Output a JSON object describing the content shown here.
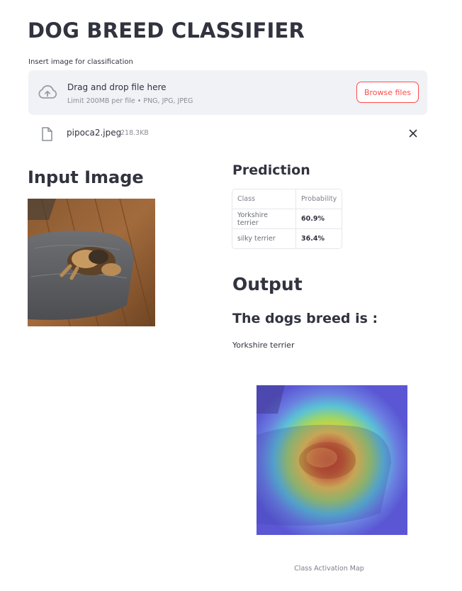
{
  "page": {
    "title": "DOG BREED CLASSIFIER"
  },
  "uploader": {
    "label": "Insert image for classification",
    "drop_text": "Drag and drop file here",
    "limit_text": "Limit 200MB per file • PNG, JPG, JPEG",
    "browse_label": "Browse files",
    "icon": "cloud-upload-icon"
  },
  "uploaded_file": {
    "name": "pipoca2.jpeg",
    "size": "218.3KB",
    "icon": "file-icon",
    "remove_icon": "close-icon"
  },
  "input_section": {
    "heading": "Input Image"
  },
  "prediction": {
    "heading": "Prediction",
    "columns": [
      "Class",
      "Probability"
    ],
    "rows": [
      {
        "class": "Yorkshire terrier",
        "probability": "60.9%"
      },
      {
        "class": "silky terrier",
        "probability": "36.4%"
      }
    ]
  },
  "output": {
    "heading": "Output",
    "breed_heading": "The dogs breed is :",
    "breed_value": "Yorkshire terrier",
    "cam_caption": "Class Activation Map"
  },
  "colors": {
    "accent": "#ff4b4b",
    "dropzone_bg": "#f0f2f6",
    "text": "#31333f"
  }
}
